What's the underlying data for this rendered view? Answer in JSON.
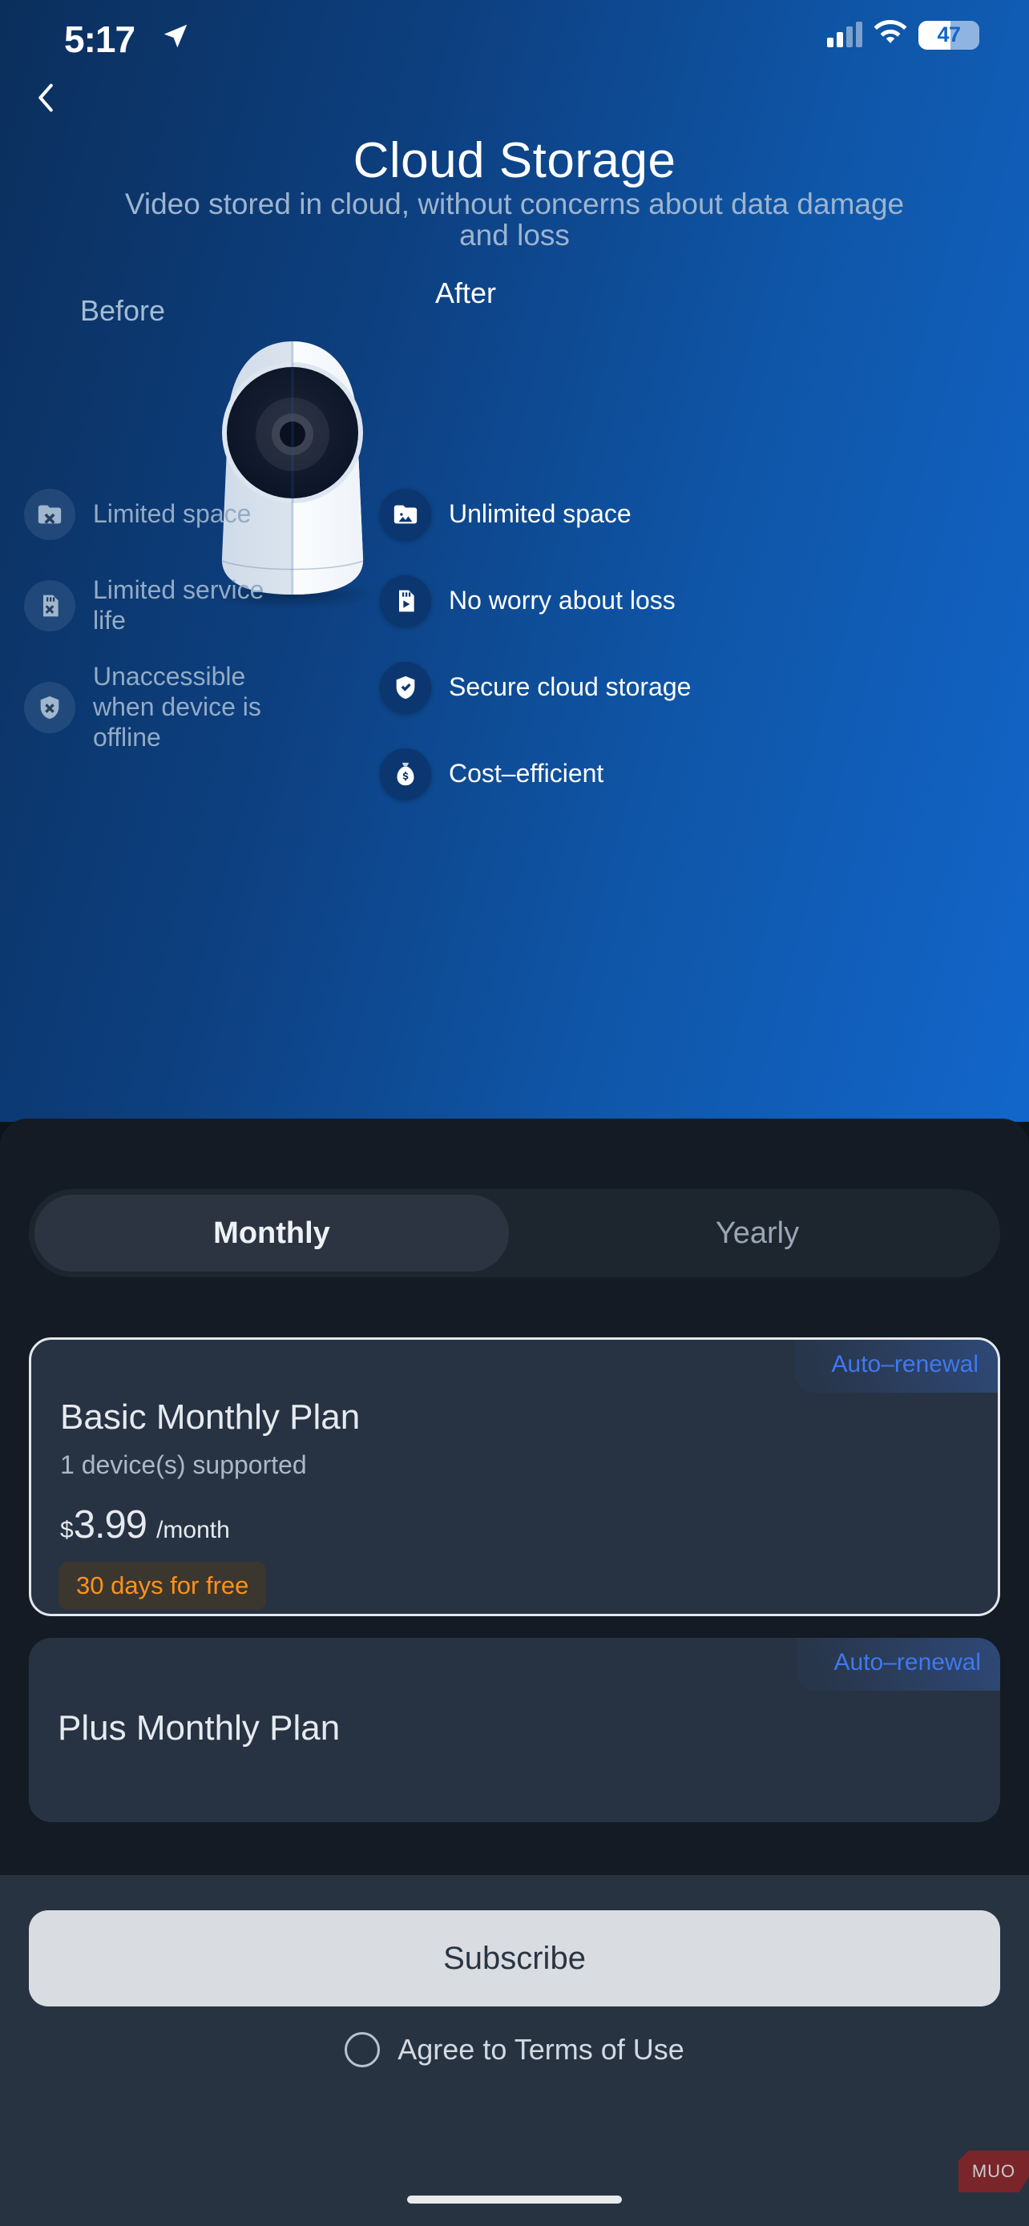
{
  "status_bar": {
    "time": "5:17",
    "location_icon": "location-arrow-icon",
    "cellular_icon": "cellular-bars-icon",
    "wifi_icon": "wifi-icon",
    "battery_percent": "47",
    "battery_icon": "battery-icon"
  },
  "header": {
    "back_icon": "chevron-left-icon",
    "title": "Cloud Storage",
    "subtitle": "Video stored in cloud, without concerns about data damage and loss"
  },
  "comparison": {
    "before_label": "Before",
    "after_label": "After",
    "device_illustration": "security-camera-illustration",
    "before_items": [
      {
        "icon": "folder-x-icon",
        "label": "Limited space"
      },
      {
        "icon": "sdcard-x-icon",
        "label": "Limited service life"
      },
      {
        "icon": "shield-x-icon",
        "label": "Unaccessible when device is offline"
      }
    ],
    "after_items": [
      {
        "icon": "folder-image-icon",
        "label": "Unlimited space"
      },
      {
        "icon": "sdcard-play-icon",
        "label": "No worry about loss"
      },
      {
        "icon": "shield-check-icon",
        "label": "Secure cloud storage"
      },
      {
        "icon": "money-bag-icon",
        "label": "Cost–efficient"
      }
    ]
  },
  "billing_toggle": {
    "options": [
      {
        "label": "Monthly",
        "selected": true
      },
      {
        "label": "Yearly",
        "selected": false
      }
    ]
  },
  "plans": [
    {
      "name": "Basic Monthly Plan",
      "devices": "1 device(s) supported",
      "currency": "$",
      "amount": "3.99",
      "period": "/month",
      "trial_badge": "30 days for free",
      "auto_renewal_badge": "Auto–renewal",
      "selected": true
    },
    {
      "name": "Plus Monthly Plan",
      "auto_renewal_badge": "Auto–renewal",
      "selected": false
    }
  ],
  "footer": {
    "subscribe_label": "Subscribe",
    "terms_label": "Agree to Terms of Use",
    "terms_checked": false,
    "watermark": "MUO"
  },
  "colors": {
    "hero_gradient_start": "#0b2f5c",
    "hero_gradient_end": "#1266cb",
    "panel_bg": "#141b24",
    "card_bg": "#273343",
    "accent_blue": "#3f79ef",
    "accent_orange": "#ff9219",
    "subscribe_bg": "#d9dde1"
  }
}
